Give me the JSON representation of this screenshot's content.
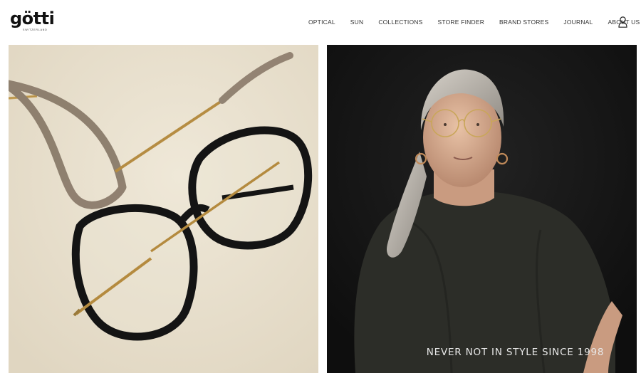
{
  "brand": {
    "name": "götti",
    "tagline_small": "SWITZERLAND"
  },
  "nav": {
    "items": [
      {
        "label": "OPTICAL"
      },
      {
        "label": "SUN"
      },
      {
        "label": "COLLECTIONS"
      },
      {
        "label": "STORE FINDER"
      },
      {
        "label": "BRAND STORES"
      },
      {
        "label": "JOURNAL"
      },
      {
        "label": "ABOUT US"
      }
    ],
    "account_icon": "user-icon"
  },
  "hero": {
    "left_image": "eyeglasses-product-photo",
    "right_image": "woman-wearing-glasses-portrait",
    "tagline": "NEVER NOT IN STYLE SINCE 1998"
  },
  "colors": {
    "left_bg": "#e8e0cf",
    "right_bg": "#121212",
    "frame_black": "#151515",
    "frame_taupe": "#8f8070",
    "gold": "#c9a65a"
  }
}
